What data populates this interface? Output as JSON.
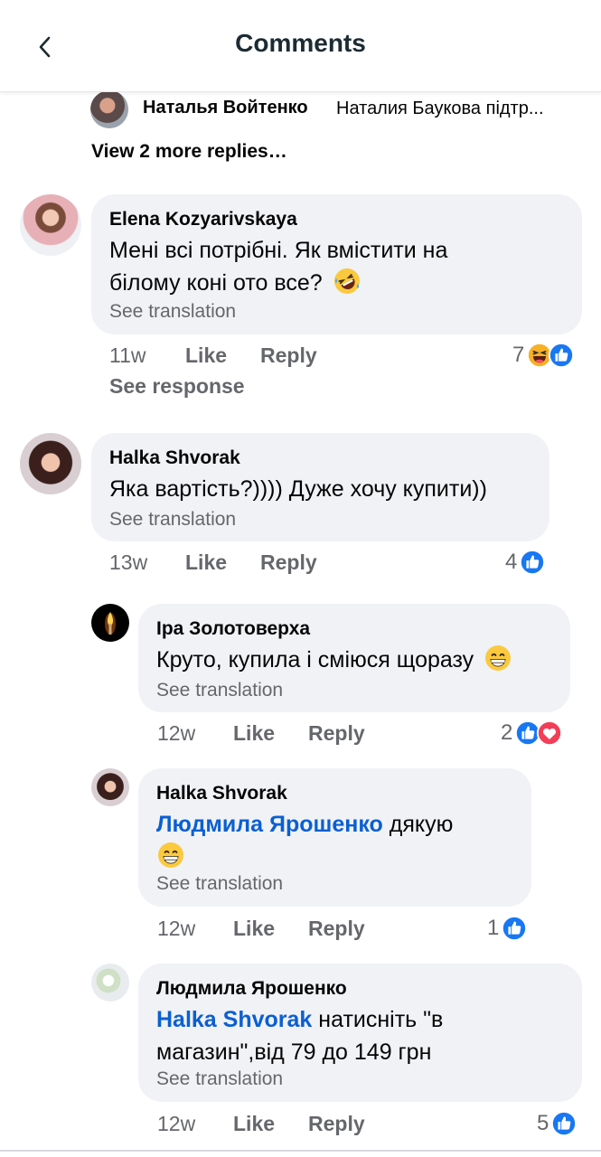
{
  "header": {
    "title": "Comments",
    "back_icon": "chevron-left-icon"
  },
  "collapsed_reply": {
    "author": "Наталья Войтенко",
    "snippet": "Наталия Баукова підтр..."
  },
  "view_more_label": "View 2 more replies…",
  "comments": [
    {
      "author": "Elena Kozyarivskaya",
      "text_line1": "Мені всі потрібні. Як вмістити на",
      "text_line2": "білому коні ото все?",
      "see_translation": "See translation",
      "time": "11w",
      "like": "Like",
      "reply": "Reply",
      "reaction_count": "7",
      "reactions": [
        "haha",
        "like"
      ],
      "see_response": "See response"
    },
    {
      "author": "Halka Shvorak",
      "text": "Яка вартість?)))) Дуже хочу купити))",
      "see_translation": "See translation",
      "time": "13w",
      "like": "Like",
      "reply": "Reply",
      "reaction_count": "4",
      "reactions": [
        "like"
      ]
    },
    {
      "author": "Іра Золотоверха",
      "text": "Круто, купила і сміюся щоразу",
      "see_translation": "See translation",
      "time": "12w",
      "like": "Like",
      "reply": "Reply",
      "reaction_count": "2",
      "reactions": [
        "like",
        "love"
      ]
    },
    {
      "author": "Halka Shvorak",
      "mention": "Людмила Ярошенко",
      "text": "дякую",
      "see_translation": "See translation",
      "time": "12w",
      "like": "Like",
      "reply": "Reply",
      "reaction_count": "1",
      "reactions": [
        "like"
      ]
    },
    {
      "author": "Людмила Ярошенко",
      "mention": "Halka Shvorak",
      "text_line1": "натисніть \"в",
      "text_line2": "магазин\",від 79 до 149 грн",
      "see_translation": "See translation",
      "time": "12w",
      "like": "Like",
      "reply": "Reply",
      "reaction_count": "5",
      "reactions": [
        "like"
      ]
    }
  ],
  "colors": {
    "like_blue": "#1877f2",
    "love_red": "#f33e58",
    "haha_yellow": "#f7b125",
    "mention_blue": "#0a5fd3",
    "bubble_bg": "#f0f2f5"
  }
}
